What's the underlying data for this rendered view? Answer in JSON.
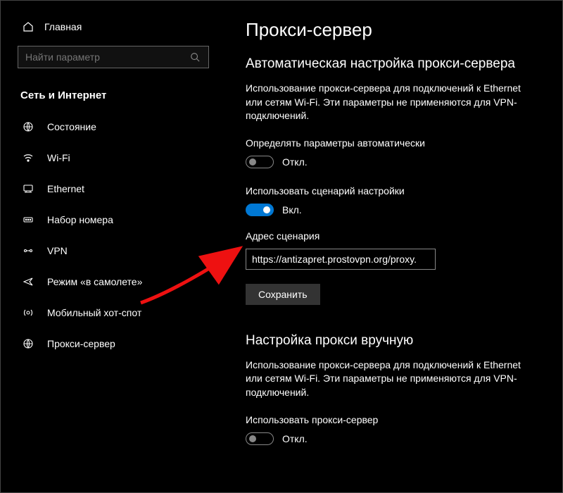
{
  "sidebar": {
    "home_label": "Главная",
    "search_placeholder": "Найти параметр",
    "section_title": "Сеть и Интернет",
    "items": [
      {
        "label": "Состояние"
      },
      {
        "label": "Wi-Fi"
      },
      {
        "label": "Ethernet"
      },
      {
        "label": "Набор номера"
      },
      {
        "label": "VPN"
      },
      {
        "label": "Режим «в самолете»"
      },
      {
        "label": "Мобильный хот-спот"
      },
      {
        "label": "Прокси-сервер"
      }
    ]
  },
  "main": {
    "page_title": "Прокси-сервер",
    "auto": {
      "heading": "Автоматическая настройка прокси-сервера",
      "description": "Использование прокси-сервера для подключений к Ethernet или сетям Wi-Fi. Эти параметры не применяются для VPN-подключений.",
      "detect_label": "Определять параметры автоматически",
      "detect_state": "Откл.",
      "script_label": "Использовать сценарий настройки",
      "script_state": "Вкл.",
      "address_label": "Адрес сценария",
      "address_value": "https://antizapret.prostovpn.org/proxy.",
      "save_label": "Сохранить"
    },
    "manual": {
      "heading": "Настройка прокси вручную",
      "description": "Использование прокси-сервера для подключений к Ethernet или сетям Wi-Fi. Эти параметры не применяются для VPN-подключений.",
      "use_label": "Использовать прокси-сервер",
      "use_state": "Откл."
    }
  }
}
